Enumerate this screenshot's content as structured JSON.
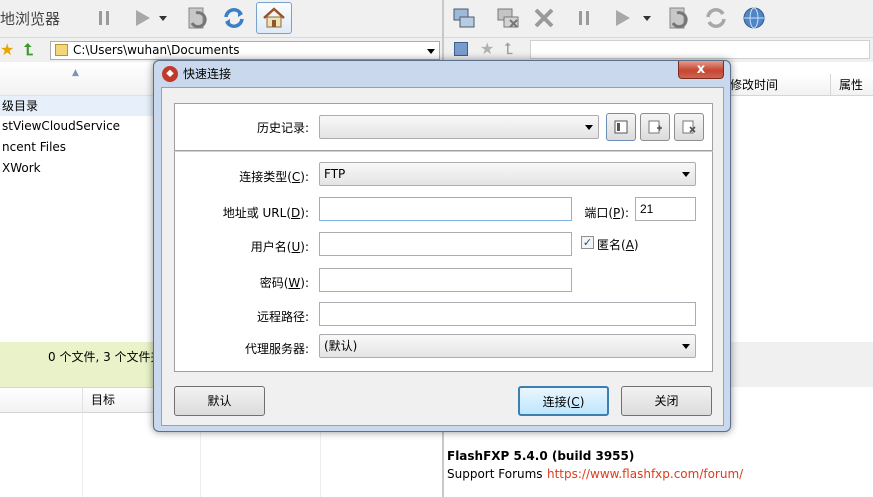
{
  "toolbar": {
    "left_title": "地浏览器",
    "icons_left": [
      "pause-icon",
      "play-icon",
      "dropdown-arrow-icon",
      "refresh-transfer-icon",
      "refresh-icon",
      "home-icon"
    ],
    "icons_right": [
      "connect-icon",
      "disconnect-icon",
      "abort-icon",
      "pause-icon",
      "play-icon",
      "dropdown-arrow-icon",
      "refresh-transfer-icon",
      "refresh-icon",
      "globe-icon"
    ]
  },
  "left_panel": {
    "path": "C:\\Users\\wuhan\\Documents",
    "column_header": "",
    "rows": [
      "级目录",
      "stViewCloudService",
      "ncent Files",
      "XWork"
    ],
    "status": "0 个文件, 3 个文件夹",
    "queue_header": "目标"
  },
  "right_panel": {
    "columns": [
      "修改时间",
      "属性"
    ]
  },
  "log": {
    "line1": "FlashFXP 5.4.0 (build 3955)",
    "line2_label": "Support Forums",
    "line2_link": "https://www.flashfxp.com/forum/"
  },
  "dialog": {
    "title": "快速连接",
    "close_label": "x",
    "history_label": "历史记录:",
    "history_value": "",
    "conn_type_label": "连接类型(",
    "conn_type_key": "C",
    "conn_type_value": "FTP",
    "address_label": "地址或 URL(",
    "address_key": "D",
    "address_value": "",
    "port_label": "端口(",
    "port_key": "P",
    "port_value": "21",
    "username_label": "用户名(",
    "username_key": "U",
    "username_value": "",
    "anonymous_label": "匿名(",
    "anonymous_key": "A",
    "anonymous_checked": true,
    "password_label": "密码(",
    "password_key": "W",
    "password_value": "",
    "remote_path_label": "远程路径:",
    "remote_path_value": "",
    "proxy_label": "代理服务器:",
    "proxy_value": "(默认)",
    "default_button": "默认",
    "connect_button": "连接(",
    "connect_key": "C",
    "close_button": "关闭"
  }
}
